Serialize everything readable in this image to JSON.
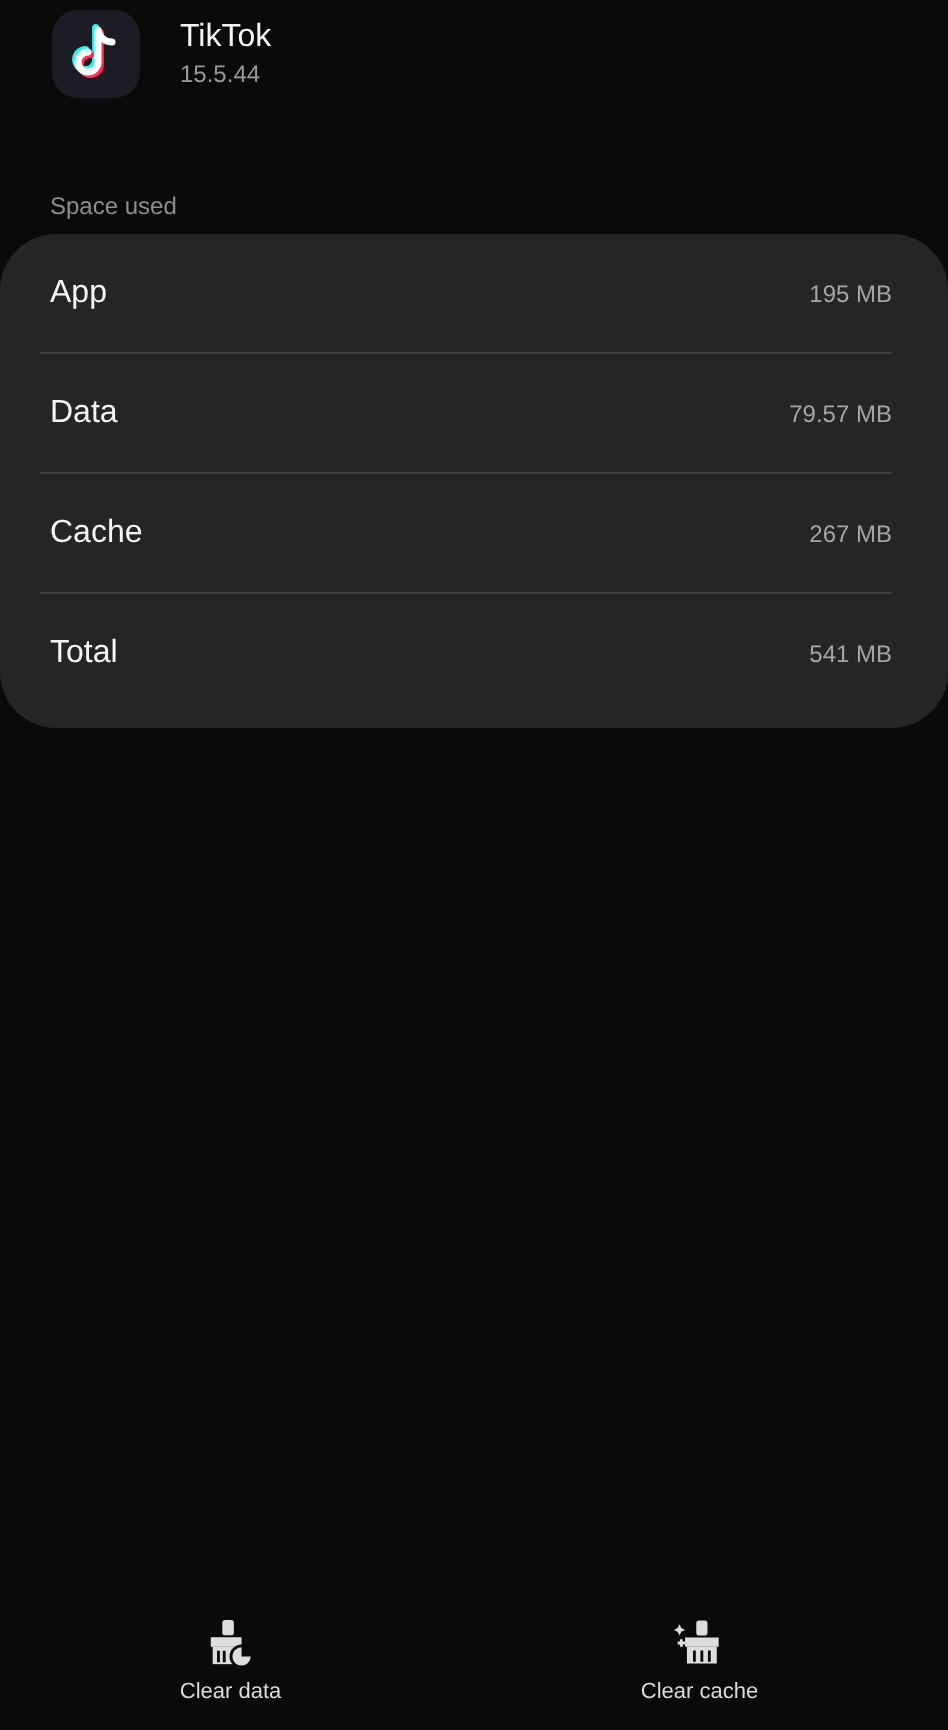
{
  "app": {
    "name": "TikTok",
    "version": "15.5.44"
  },
  "section_label": "Space used",
  "storage": [
    {
      "label": "App",
      "value": "195 MB"
    },
    {
      "label": "Data",
      "value": "79.57 MB"
    },
    {
      "label": "Cache",
      "value": "267 MB"
    },
    {
      "label": "Total",
      "value": "541 MB"
    }
  ],
  "actions": [
    {
      "kind": "clear-data",
      "label": "Clear data"
    },
    {
      "kind": "clear-cache",
      "label": "Clear cache"
    }
  ]
}
